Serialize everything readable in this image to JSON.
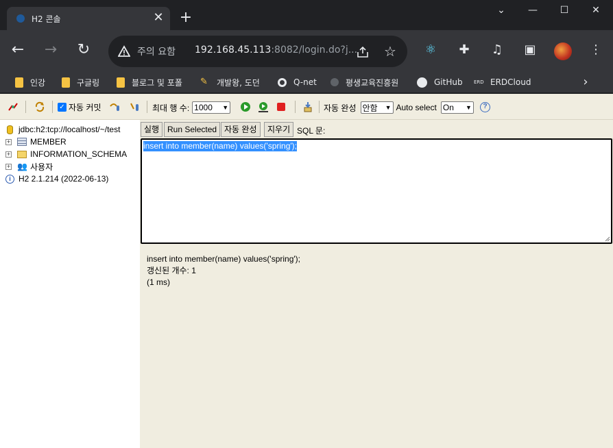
{
  "window": {
    "tab_title": "H2 콘솔",
    "tab_close": "✕",
    "new_tab": "+",
    "minimize": "⌄",
    "min": "—",
    "max": "☐",
    "close": "✕"
  },
  "toolbar": {
    "back": "←",
    "forward": "→",
    "reload": "↻",
    "security_label": "주의 요함",
    "url_host": "192.168.45.113",
    "url_rest": ":8082/login.do?j...",
    "icons": [
      "warning-icon",
      "share-icon",
      "star-icon",
      "react-devtools-icon",
      "extensions-icon",
      "media-control-icon",
      "side-panel-icon",
      "profile-avatar",
      "menu-icon"
    ]
  },
  "bookmarks": [
    {
      "label": "인강",
      "icon": "folder-icon"
    },
    {
      "label": "구글링",
      "icon": "folder-icon"
    },
    {
      "label": "블로그 및 포폴",
      "icon": "folder-icon"
    },
    {
      "label": "개발왕, 도던",
      "icon": "bookmark-icon"
    },
    {
      "label": "Q-net",
      "icon": "qnet-icon"
    },
    {
      "label": "평생교육진흥원",
      "icon": "nile-icon"
    },
    {
      "label": "GitHub",
      "icon": "github-icon"
    },
    {
      "label": "ERDCloud",
      "icon": "erdcloud-icon"
    }
  ],
  "h2": {
    "toolbar": {
      "autocommit_label": "자동 커밋",
      "autocommit_checked": true,
      "max_rows_label": "최대 행 수:",
      "max_rows_value": "1000",
      "autocomplete_label": "자동 완성",
      "autocomplete_value": "안함",
      "autoselect_label": "Auto select",
      "autoselect_value": "On",
      "help": "?"
    },
    "tree": {
      "connection": "jdbc:h2:tcp://localhost/~/test",
      "items": [
        "MEMBER",
        "INFORMATION_SCHEMA",
        "사용자"
      ],
      "version": "H2 2.1.214 (2022-06-13)"
    },
    "buttons": {
      "run": "실행",
      "run_selected": "Run Selected",
      "autocomplete": "자동 완성",
      "clear": "지우기"
    },
    "sql_label": "SQL 문:",
    "sql_text": "insert into member(name) values('spring');",
    "result": [
      "insert into member(name) values('spring');",
      "갱신된 개수: 1",
      "(1 ms)"
    ]
  },
  "colors": {
    "chrome_bg": "#202124",
    "toolbar_bg": "#35363a",
    "h2_panel": "#f0ede0",
    "selection": "#3390ff"
  }
}
